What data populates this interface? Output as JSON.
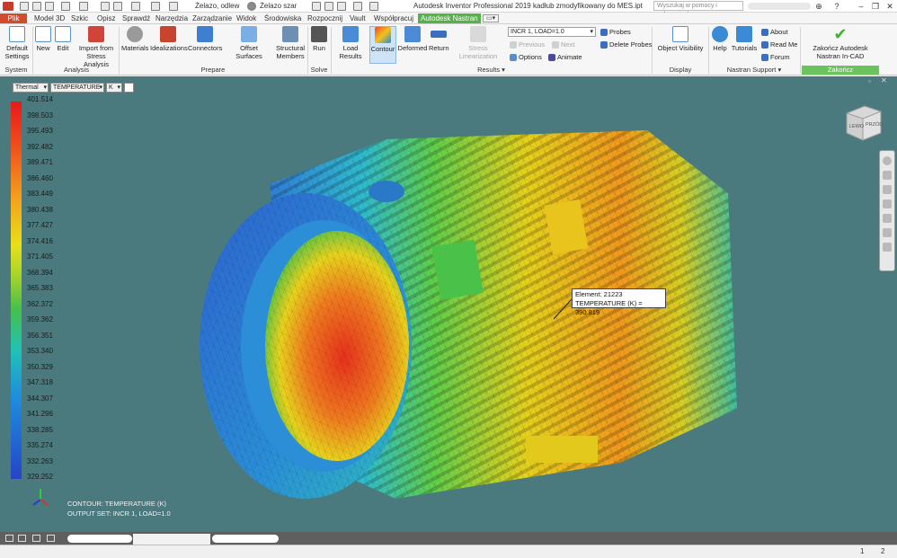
{
  "titlebar": {
    "quick_material": "Żelazo, odlew",
    "quick_appearance": "Żelazo szar",
    "title": "Autodesk Inventor Professional 2019    kadłub zmodyfikowany do MES.ipt",
    "search_placeholder": "Wyszukaj w pomocy i poleceniach"
  },
  "menu": {
    "tabs": [
      "Plik",
      "Model 3D",
      "Szkic",
      "Opisz",
      "Sprawdź",
      "Narzędzia",
      "Zarządzanie",
      "Widok",
      "Środowiska",
      "Rozpocznij",
      "Vault",
      "Współpracuj",
      "Autodesk Nastran"
    ]
  },
  "ribbon": {
    "system": {
      "label": "System",
      "default_settings": "Default Settings"
    },
    "analysis": {
      "label": "Analysis",
      "new": "New",
      "edit": "Edit",
      "import": "Import from Stress Analysis"
    },
    "prepare": {
      "label": "Prepare",
      "materials": "Materials",
      "idealizations": "Idealizations",
      "connectors": "Connectors",
      "offset_surfaces": "Offset Surfaces",
      "structural_members": "Structural Members"
    },
    "solve": {
      "label": "Solve",
      "run": "Run"
    },
    "results": {
      "label": "Results",
      "load_results": "Load Results",
      "contour": "Contour",
      "deformed": "Deformed",
      "return": "Return",
      "stress_lin": "Stress Linearization",
      "incr": "INCR 1, LOAD=1.0",
      "previous": "Previous",
      "next": "Next",
      "options": "Options",
      "animate": "Animate",
      "probes": "Probes",
      "delete_probes": "Delete Probes"
    },
    "display": {
      "label": "Display",
      "object_visibility": "Object Visibility"
    },
    "support": {
      "label": "Nastran Support",
      "help": "Help",
      "tutorials": "Tutorials",
      "about": "About",
      "read_me": "Read Me",
      "forum": "Forum"
    },
    "finish": {
      "label": "Zakończ",
      "button": "Zakończ Autodesk Nastran In-CAD"
    }
  },
  "viewport": {
    "dropdown_type": "Thermal",
    "dropdown_result": "TEMPERATURE",
    "dropdown_unit": "K",
    "legend": [
      "401.514",
      "398.503",
      "395.493",
      "392.482",
      "389.471",
      "386.460",
      "383.449",
      "380.438",
      "377.427",
      "374.416",
      "371.405",
      "368.394",
      "365.383",
      "362.372",
      "359.362",
      "356.351",
      "353.340",
      "350.329",
      "347.318",
      "344.307",
      "341.296",
      "338.285",
      "335.274",
      "332.263",
      "329.252"
    ],
    "probe_element": "Element: 21223",
    "probe_value": "TEMPERATURE (K)  =  390.819",
    "caption_contour": "CONTOUR: TEMPERATURE (K)",
    "caption_output": "OUTPUT SET: INCR 1, LOAD=1.0",
    "viewcube_left": "LEWO",
    "viewcube_front": "PRZÓD"
  },
  "bottom": {
    "page1": "1",
    "page2": "2"
  }
}
